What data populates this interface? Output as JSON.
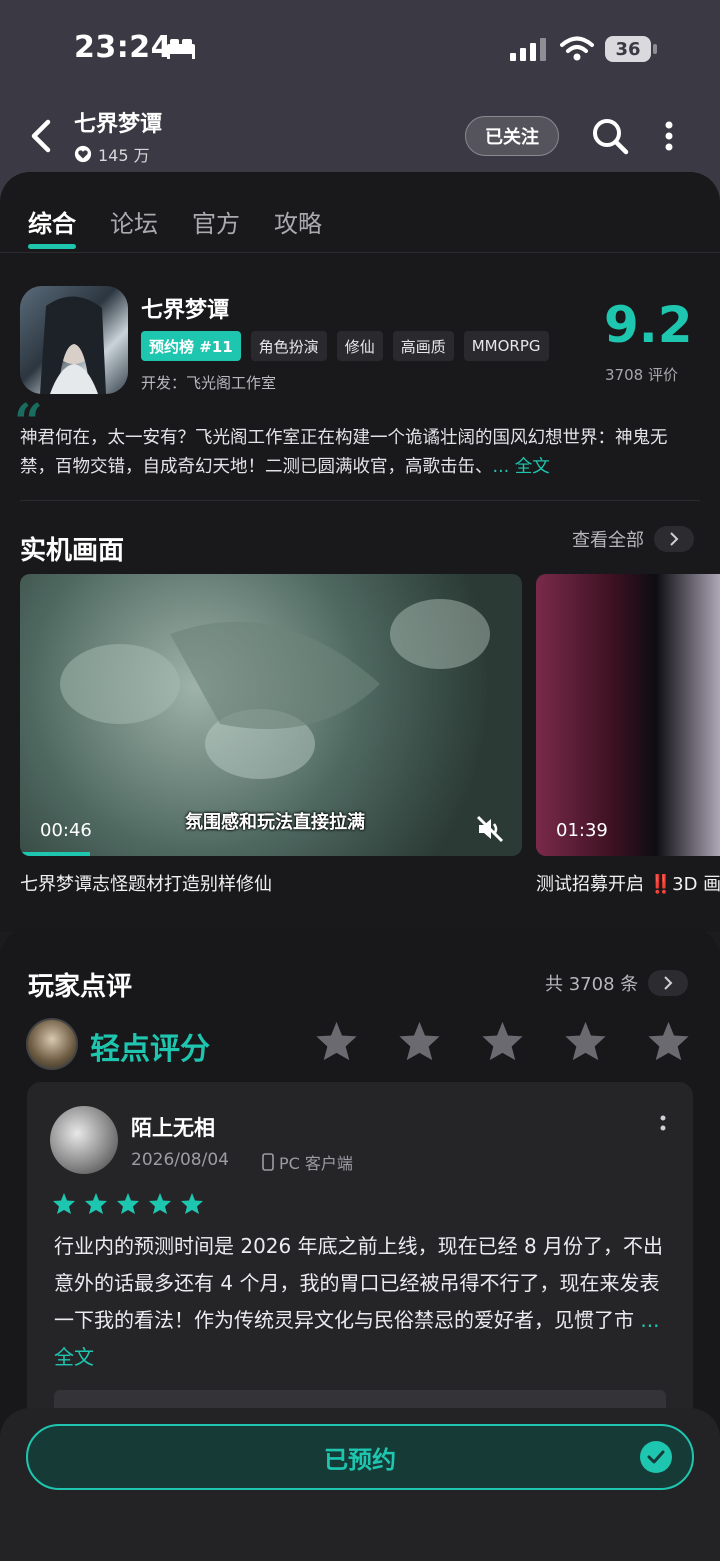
{
  "status_bar": {
    "time": "23:24",
    "battery": "36"
  },
  "header": {
    "title": "七界梦谭",
    "likes": "145 万",
    "follow_label": "已关注"
  },
  "tabs": [
    {
      "label": "综合",
      "active": true
    },
    {
      "label": "论坛",
      "active": false
    },
    {
      "label": "官方",
      "active": false
    },
    {
      "label": "攻略",
      "active": false
    }
  ],
  "game": {
    "title": "七界梦谭",
    "rank_tag": "预约榜 #11",
    "tags": [
      "角色扮演",
      "修仙",
      "高画质",
      "MMORPG"
    ],
    "developer": "开发：飞光阁工作室",
    "score": "9.2",
    "rating_count": "3708 评价",
    "description": "神君何在，太一安有？飞光阁工作室正在构建一个诡谲壮阔的国风幻想世界：神鬼无禁，百物交错，自成奇幻天地！二测已圆满收官，高歌击缶、",
    "more_label": "... 全文"
  },
  "gameplay": {
    "title": "实机画面",
    "view_all": "查看全部",
    "videos": [
      {
        "duration": "00:46",
        "subtitle": "氛围感和玩法直接拉满",
        "caption": "七界梦谭志怪题材打造别样修仙"
      },
      {
        "duration": "01:39",
        "caption": "测试招募开启 ‼️3D 画"
      }
    ]
  },
  "reviews": {
    "title": "玩家点评",
    "count": "共 3708 条",
    "rate_label": "轻点评分",
    "item": {
      "name": "陌上无相",
      "date": "2026/08/04",
      "device": "PC 客户端",
      "stars": 5,
      "body": "行业内的预测时间是 2026 年底之前上线，现在已经 8 月份了，不出意外的话最多还有 4 个月，我的胃口已经被吊得不行了，现在来发表一下我的看法！作为传统灵异文化与民俗禁忌的爱好者，见惯了市",
      "more_label": "... 全文"
    }
  },
  "bottom": {
    "reserve_label": "已预约"
  },
  "colors": {
    "accent": "#1ec6b0",
    "header_bg": "#3b3a44",
    "page_bg": "#19191b"
  }
}
